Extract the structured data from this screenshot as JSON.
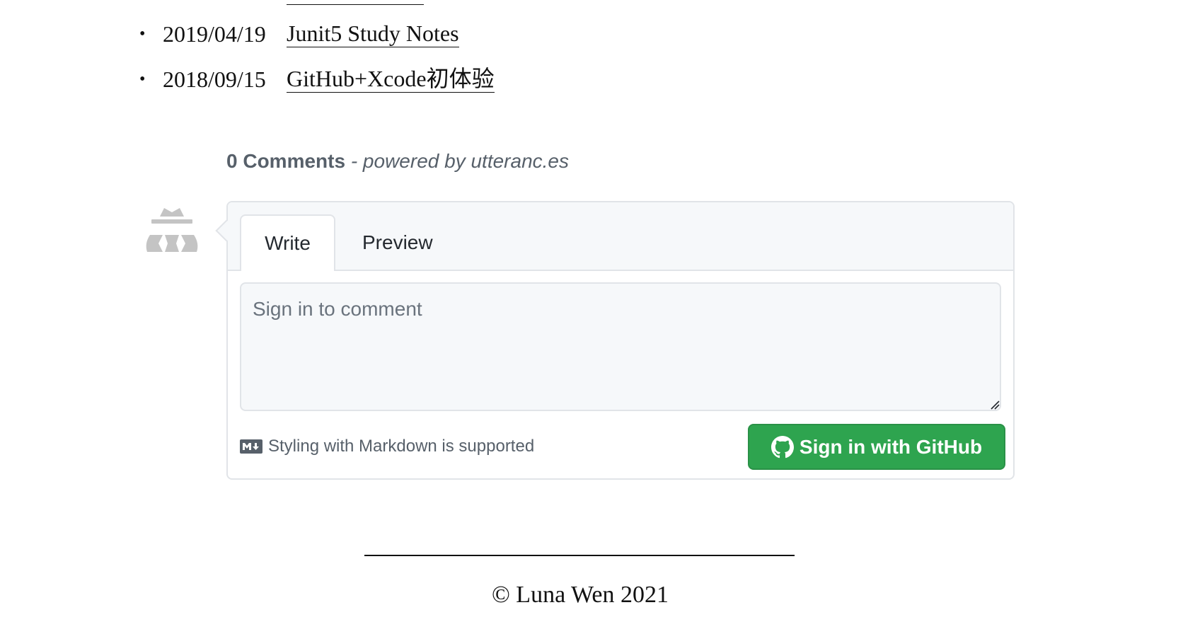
{
  "posts": [
    {
      "date": "2019/04/19",
      "title": "Junit5 Study Notes"
    },
    {
      "date": "2018/09/15",
      "title": "GitHub+Xcode初体验"
    }
  ],
  "comments": {
    "count_label": "0 Comments",
    "powered_by": " - powered by utteranc.es",
    "tabs": [
      "Write",
      "Preview"
    ],
    "placeholder": "Sign in to comment",
    "markdown_note": "Styling with Markdown is supported",
    "signin_label": "Sign in with GitHub"
  },
  "colors": {
    "accent_green": "#2ea44f",
    "muted_text": "#57606a"
  },
  "icons": {
    "avatar": "anonymous-avatar-icon",
    "markdown": "markdown-icon",
    "github": "github-icon"
  },
  "footer": {
    "copyright": "© Luna Wen 2021"
  }
}
